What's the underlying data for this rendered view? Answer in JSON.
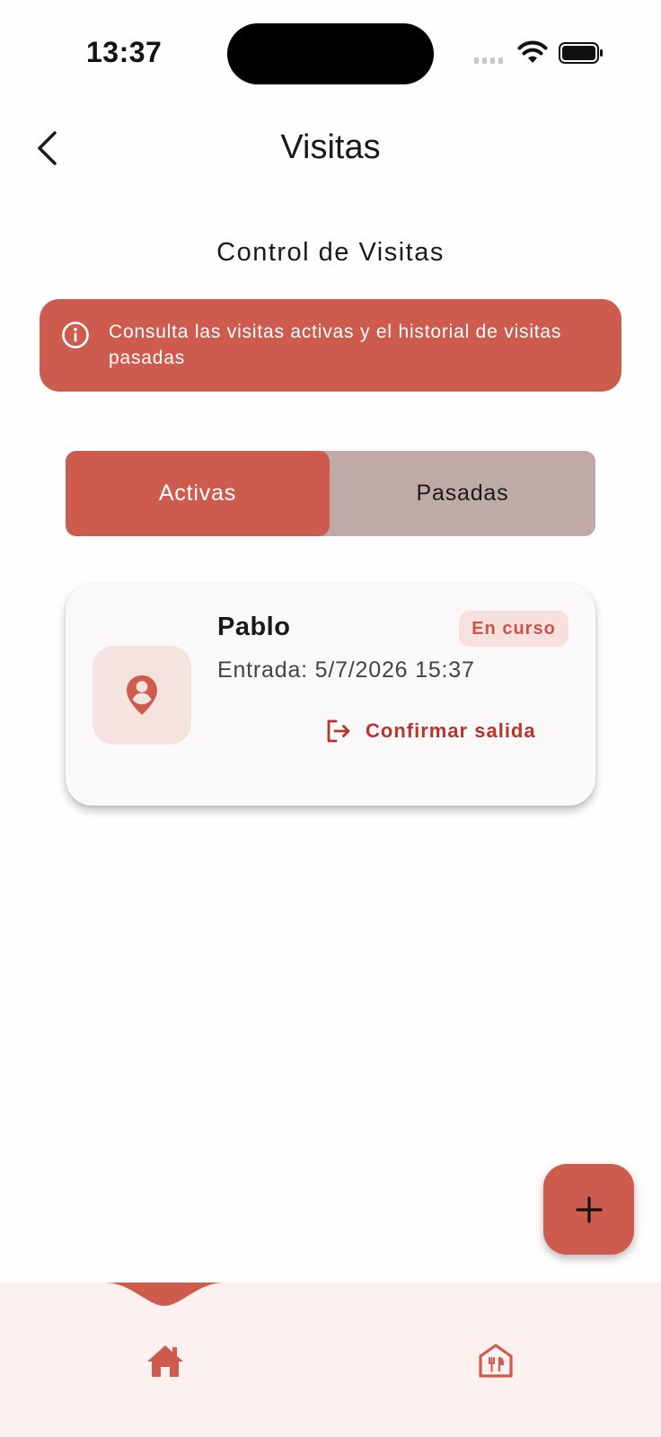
{
  "status_bar": {
    "time": "13:37"
  },
  "header": {
    "title": "Visitas"
  },
  "section": {
    "title": "Control de Visitas"
  },
  "info_banner": {
    "text": "Consulta las visitas activas y el historial de visitas pasadas"
  },
  "tabs": [
    {
      "label": "Activas",
      "selected": true
    },
    {
      "label": "Pasadas",
      "selected": false
    }
  ],
  "visits": [
    {
      "name": "Pablo",
      "status": "En curso",
      "entry": "Entrada: 5/7/2026 15:37",
      "action_label": "Confirmar salida"
    }
  ],
  "bottom_nav": {
    "items": [
      {
        "icon": "home-icon",
        "selected": true
      },
      {
        "icon": "restaurant-house-icon",
        "selected": false
      }
    ]
  },
  "colors": {
    "accent": "#cd5c4f",
    "accent_dark": "#b8352b",
    "tab_inactive": "#bfaaa7",
    "nav_background": "#fcf1ef",
    "badge_background": "#f6e1de"
  }
}
